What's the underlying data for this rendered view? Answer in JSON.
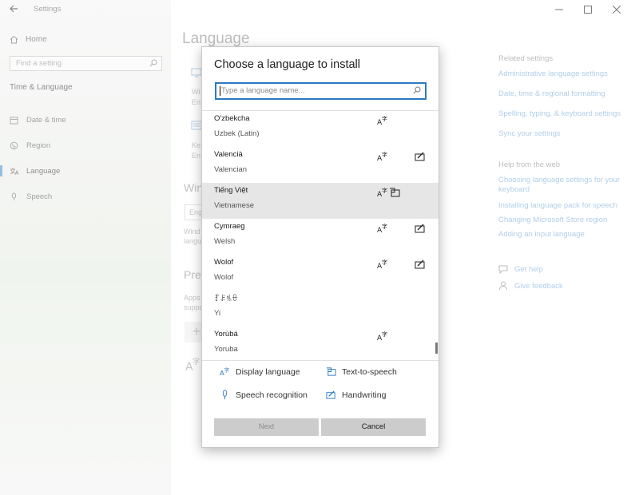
{
  "window": {
    "app_title": "Settings",
    "page_title": "Language"
  },
  "nav": {
    "home": "Home",
    "search_placeholder": "Find a setting",
    "section": "Time & Language",
    "items": [
      {
        "label": "Date & time",
        "icon": "calendar-icon"
      },
      {
        "label": "Region",
        "icon": "globe-icon"
      },
      {
        "label": "Language",
        "icon": "language-icon",
        "active": true
      },
      {
        "label": "Speech",
        "icon": "microphone-icon"
      }
    ]
  },
  "background": {
    "frag_wi": "Wi",
    "frag_en": "En",
    "frag_ke": "Ke",
    "frag_en2": "En",
    "heading_win": "Win",
    "input_frag": "Eng",
    "frag_wind": "Wind",
    "frag_langu": "langu",
    "heading_pref": "Pref",
    "frag_apps": "Apps",
    "frag_suppo": "suppo",
    "add_glyph": "+"
  },
  "related": {
    "header": "Related settings",
    "links": [
      "Administrative language settings",
      "Date, time & regional formatting",
      "Spelling, typing, & keyboard settings",
      "Sync your settings"
    ],
    "help_header": "Help from the web",
    "help_links": [
      "Choosing language settings for your keyboard",
      "Installing language pack for speech",
      "Changing Microsoft Store region",
      "Adding an input language"
    ],
    "get_help": "Get help",
    "give_feedback": "Give feedback"
  },
  "dialog": {
    "title": "Choose a language to install",
    "search_placeholder": "Type a language name...",
    "languages": [
      {
        "native": "O'zbekcha",
        "english": "Uzbek (Latin)",
        "features": [
          "display"
        ]
      },
      {
        "native": "Valencià",
        "english": "Valencian",
        "features": [
          "display",
          "handwriting"
        ]
      },
      {
        "native": "Tiếng Việt",
        "english": "Vietnamese",
        "features": [
          "display",
          "text-to-speech"
        ],
        "selected": true
      },
      {
        "native": "Cymraeg",
        "english": "Welsh",
        "features": [
          "display",
          "handwriting"
        ]
      },
      {
        "native": "Wolof",
        "english": "Wolof",
        "features": [
          "display",
          "handwriting"
        ]
      },
      {
        "native": "ꆈꌠꁱꂷ",
        "english": "Yi",
        "features": []
      },
      {
        "native": "Yorùbá",
        "english": "Yoruba",
        "features": [
          "display"
        ]
      }
    ],
    "legend": {
      "display": "Display language",
      "tts": "Text-to-speech",
      "speech": "Speech recognition",
      "handwriting": "Handwriting"
    },
    "next_label": "Next",
    "cancel_label": "Cancel",
    "accent": "#2b79c2"
  }
}
